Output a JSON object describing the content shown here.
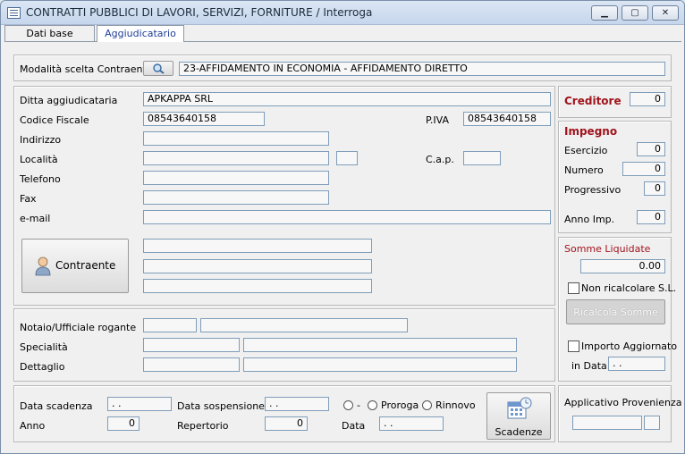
{
  "window": {
    "title": "CONTRATTI PUBBLICI DI LAVORI, SERVIZI, FORNITURE / Interroga",
    "min": "▁",
    "max": "▢",
    "close": "✕"
  },
  "tabs": [
    {
      "label": "Dati base"
    },
    {
      "label": "Aggiudicatario"
    }
  ],
  "modalita": {
    "label": "Modalità scelta Contraente",
    "value": "23-AFFIDAMENTO IN ECONOMIA - AFFIDAMENTO DIRETTO"
  },
  "ditta": {
    "ditta_label": "Ditta aggiudicataria",
    "ditta_value": "APKAPPA SRL",
    "cf_label": "Codice Fiscale",
    "cf_value": "08543640158",
    "piva_label": "P.IVA",
    "piva_value": "08543640158",
    "indirizzo_label": "Indirizzo",
    "localita_label": "Località",
    "cap_label": "C.a.p.",
    "telefono_label": "Telefono",
    "fax_label": "Fax",
    "email_label": "e-mail",
    "contraente_button": "Contraente"
  },
  "notaio": {
    "notaio_label": "Notaio/Ufficiale rogante",
    "specialita_label": "Specialità",
    "dettaglio_label": "Dettaglio"
  },
  "bottom": {
    "scadenza_label": "Data scadenza",
    "scadenza_value": " . .",
    "sospensione_label": "Data sospensione",
    "sospensione_value": " . .",
    "radio_none": "-",
    "radio_proroga": "Proroga",
    "radio_rinnovo": "Rinnovo",
    "anno_label": "Anno",
    "anno_value": "0",
    "repertorio_label": "Repertorio",
    "repertorio_value": "0",
    "data_label": "Data",
    "data_value": " . .",
    "scadenze_button": "Scadenze"
  },
  "creditore": {
    "label": "Creditore",
    "value": "0"
  },
  "impegno": {
    "title": "Impegno",
    "esercizio_label": "Esercizio",
    "esercizio_value": "0",
    "numero_label": "Numero",
    "numero_value": "0",
    "progressivo_label": "Progressivo",
    "progressivo_value": "0",
    "anno_imp_label": "Anno Imp.",
    "anno_imp_value": "0"
  },
  "somme": {
    "title": "Somme Liquidate",
    "value": "0.00",
    "non_ricalcolare": "Non ricalcolare S.L.",
    "ricalcola_button": "Ricalcola Somme",
    "importo_aggiornato": "Importo Aggiornato",
    "in_data_label": "in Data",
    "in_data_value": " . ."
  },
  "applicativo": {
    "title": "Applicativo Provenienza"
  }
}
